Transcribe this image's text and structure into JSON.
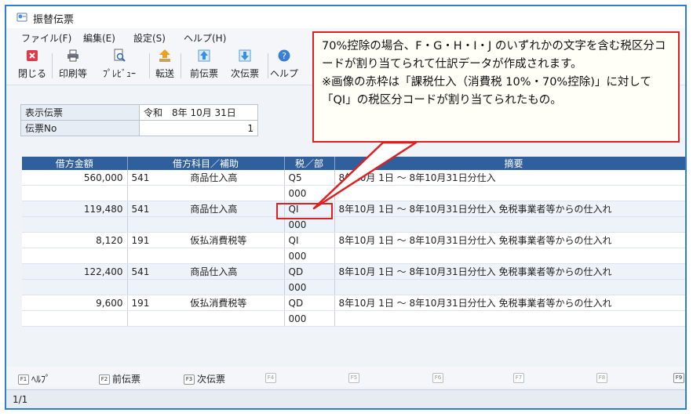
{
  "window": {
    "title": "振替伝票"
  },
  "menu": [
    "ファイル(F)",
    "編集(E)",
    "設定(S)",
    "ヘルプ(H)"
  ],
  "toolbar": {
    "close": "閉じる",
    "print": "印刷等",
    "preview": "ﾌﾟﾚﾋﾞｭｰ",
    "transfer": "転送",
    "prev": "前伝票",
    "next": "次伝票",
    "help": "ヘルプ"
  },
  "info": {
    "date_label": "表示伝票",
    "date_value": "令和　8年 10月 31日",
    "no_label": "伝票No",
    "no_value": "1"
  },
  "grid": {
    "headers": [
      "借方金額",
      "借方科目／補助",
      "税／部",
      "摘要"
    ],
    "rows": [
      {
        "amount": "560,000",
        "code": "541",
        "account": "商品仕入高",
        "tax": "Q5",
        "dept": "000",
        "memo": "8年10月 1日 ～ 8年10月31日分仕入"
      },
      {
        "amount": "119,480",
        "code": "541",
        "account": "商品仕入高",
        "tax": "QI",
        "dept": "000",
        "memo": "8年10月 1日 ～ 8年10月31日分仕入 免税事業者等からの仕入れ"
      },
      {
        "amount": "8,120",
        "code": "191",
        "account": "仮払消費税等",
        "tax": "QI",
        "dept": "000",
        "memo": "8年10月 1日 ～ 8年10月31日分仕入 免税事業者等からの仕入れ"
      },
      {
        "amount": "122,400",
        "code": "541",
        "account": "商品仕入高",
        "tax": "QD",
        "dept": "000",
        "memo": "8年10月 1日 ～ 8年10月31日分仕入 免税事業者等からの仕入れ"
      },
      {
        "amount": "9,600",
        "code": "191",
        "account": "仮払消費税等",
        "tax": "QD",
        "dept": "000",
        "memo": "8年10月 1日 ～ 8年10月31日分仕入 免税事業者等からの仕入れ"
      }
    ]
  },
  "fkeys": [
    {
      "key": "F1",
      "label": "ﾍﾙﾌﾟ"
    },
    {
      "key": "F2",
      "label": "前伝票"
    },
    {
      "key": "F3",
      "label": "次伝票"
    },
    {
      "key": "F4",
      "label": ""
    },
    {
      "key": "F5",
      "label": ""
    },
    {
      "key": "F6",
      "label": ""
    },
    {
      "key": "F7",
      "label": ""
    },
    {
      "key": "F8",
      "label": ""
    },
    {
      "key": "F9",
      "label": ""
    }
  ],
  "status": "1/1",
  "callout": {
    "line1": "70%控除の場合、F・G・H・I・J のいずれかの文字を含む税区分コードが割り当てられて仕訳データが作成されます。",
    "line2": "※画像の赤枠は「課税仕入（消費税 10%・70%控除)」に対して「QI」の税区分コードが割り当てられたもの。"
  },
  "colors": {
    "accent": "#2e7ed3",
    "header": "#2f5f9c",
    "highlight": "#e02020"
  }
}
